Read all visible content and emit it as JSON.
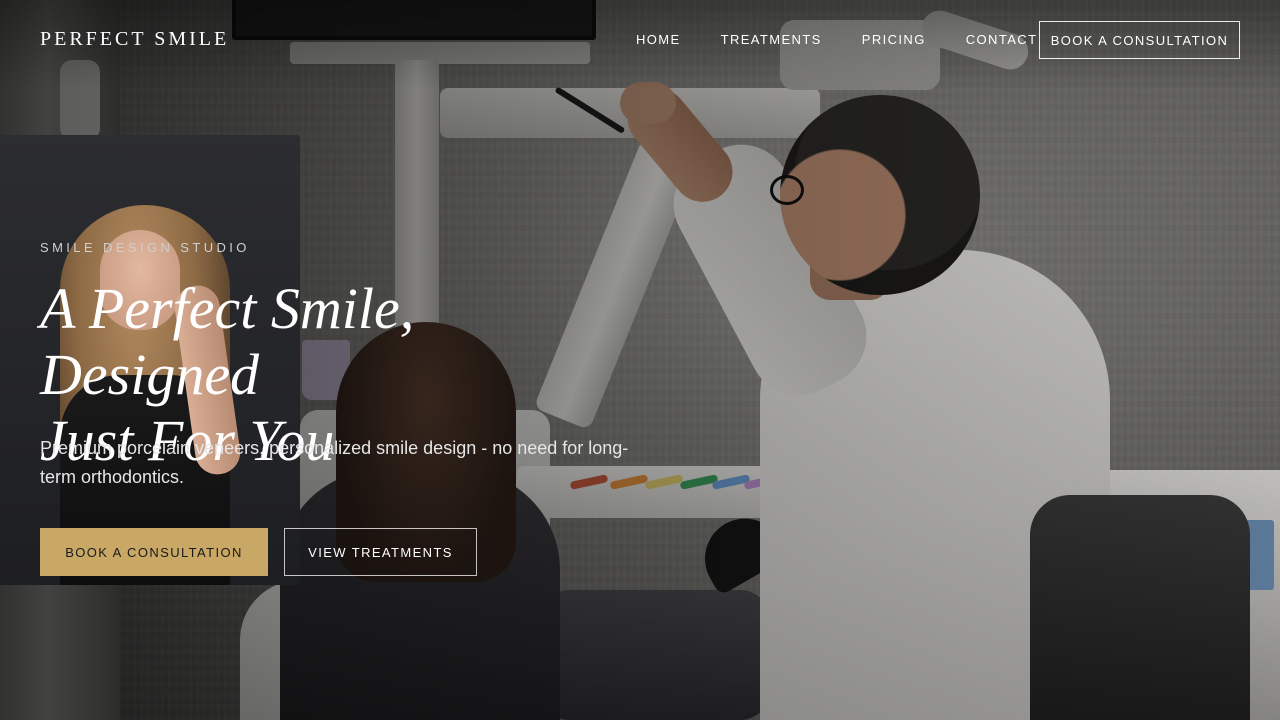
{
  "header": {
    "logo": "PERFECT SMILE",
    "nav": [
      "HOME",
      "TREATMENTS",
      "PRICING",
      "CONTACT"
    ],
    "cta_label": "BOOK A CONSULTATION"
  },
  "hero": {
    "eyebrow": "SMILE DESIGN STUDIO",
    "headline_line1": "A Perfect Smile, Designed",
    "headline_line2": "Just For You",
    "subtext": "Premium porcelain veneers, personalized smile design - no need for long-term orthodontics.",
    "primary_cta": "BOOK A CONSULTATION",
    "secondary_cta": "VIEW TREATMENTS"
  },
  "colors": {
    "accent_gold": "#c9a765",
    "text_white": "#ffffff"
  }
}
